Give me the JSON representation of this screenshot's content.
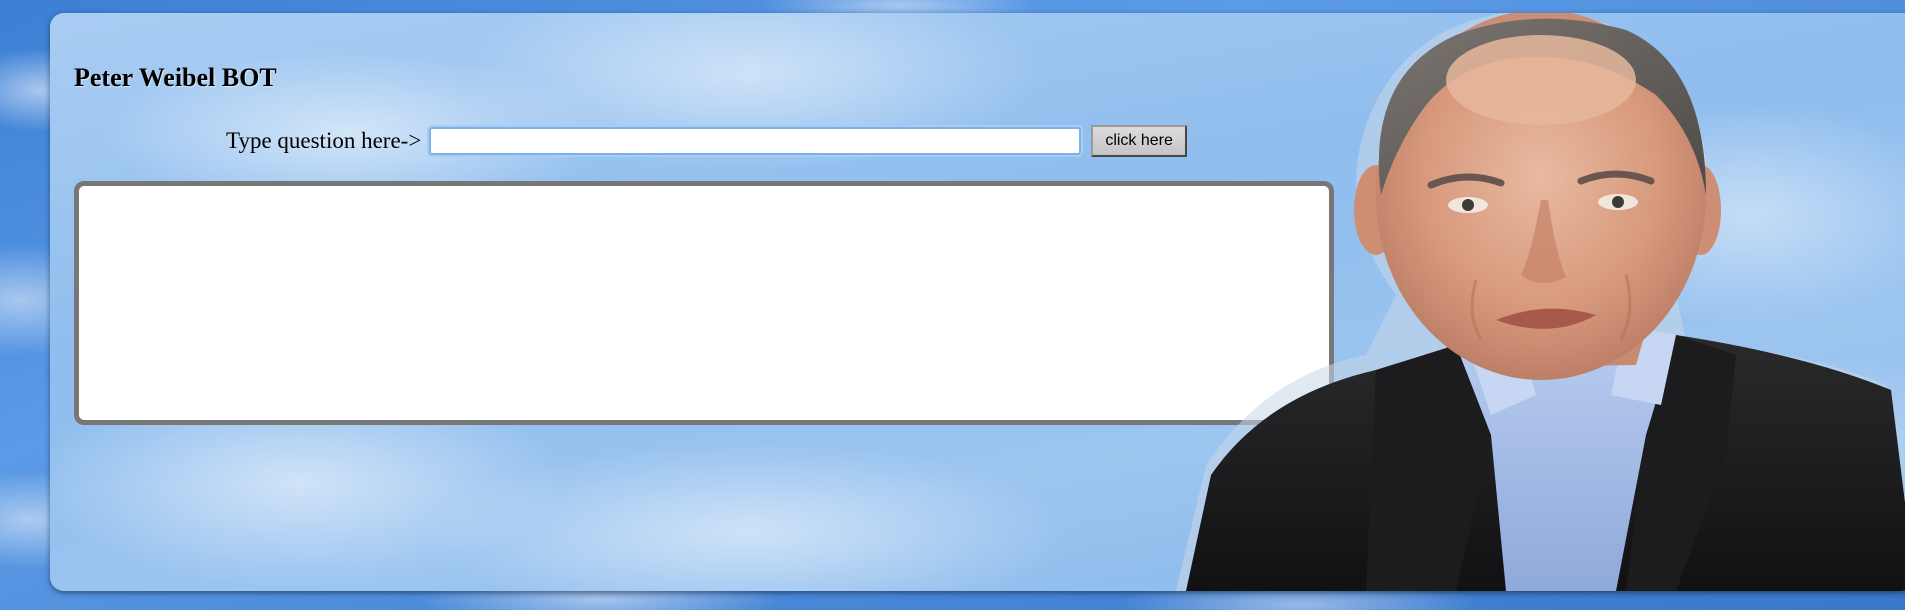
{
  "page": {
    "title": "Peter Weibel BOT"
  },
  "question_form": {
    "label": "Type question here->",
    "input_value": "",
    "button_label": "click here"
  },
  "answer": {
    "text": ""
  },
  "colors": {
    "sky_blue": "#4a88d8",
    "panel_light_blue": "#9cc5f0",
    "answer_border": "#777777",
    "input_focus": "#7fb0e8"
  },
  "icons": {
    "portrait": "man-portrait-image"
  }
}
